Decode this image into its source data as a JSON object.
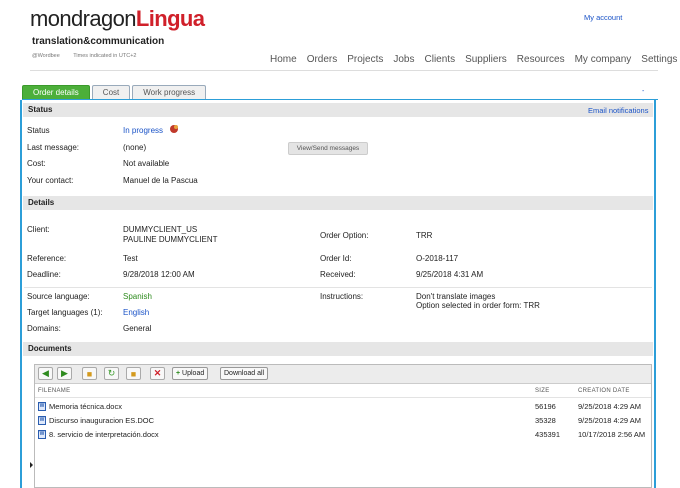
{
  "header": {
    "logo_part1": "mondragon",
    "logo_part2": "Lingua",
    "tagline": "translation&communication",
    "sub_info_1": "@Wordbee",
    "sub_info_2": "Times indicated in UTC+2",
    "my_account": "My account",
    "nav": [
      "Home",
      "Orders",
      "Projects",
      "Jobs",
      "Clients",
      "Suppliers",
      "Resources",
      "My company",
      "Settings"
    ]
  },
  "tabs": [
    "Order details",
    "Cost",
    "Work progress"
  ],
  "tab_right_marker": "-",
  "status_section": {
    "title": "Status",
    "email_link": "Email notifications",
    "status_label": "Status",
    "status_value": "In progress",
    "last_message_label": "Last message:",
    "last_message_value": "(none)",
    "view_send_button": "View/Send messages",
    "cost_label": "Cost:",
    "cost_value": "Not available",
    "contact_label": "Your contact:",
    "contact_value": "Manuel de la Pascua"
  },
  "details_section": {
    "title": "Details",
    "client_label": "Client:",
    "client_line1": "DUMMYCLIENT_US",
    "client_line2": "PAULINE DUMMYCLIENT",
    "order_option_label": "Order Option:",
    "order_option_value": "TRR",
    "reference_label": "Reference:",
    "reference_value": "Test",
    "order_id_label": "Order Id:",
    "order_id_value": "O-2018-117",
    "deadline_label": "Deadline:",
    "deadline_value": "9/28/2018 12:00 AM",
    "received_label": "Received:",
    "received_value": "9/25/2018 4:31 AM",
    "source_label": "Source language:",
    "source_value": "Spanish",
    "instructions_label": "Instructions:",
    "instructions_line1": "Don't translate images",
    "instructions_line2": "Option selected in order form: TRR",
    "target_label": "Target languages (1):",
    "target_value": "English",
    "domains_label": "Domains:",
    "domains_value": "General"
  },
  "documents_section": {
    "title": "Documents",
    "upload_button": "Upload",
    "download_all_button": "Download all",
    "columns": [
      "FILENAME",
      "SIZE",
      "CREATION DATE"
    ],
    "files": [
      {
        "name": "Memoria técnica.docx",
        "size": "56196",
        "date": "9/25/2018 4:29 AM"
      },
      {
        "name": "Discurso inauguracion ES.DOC",
        "size": "35328",
        "date": "9/25/2018 4:29 AM"
      },
      {
        "name": "8. servicio de interpretación.docx",
        "size": "435391",
        "date": "10/17/2018 2:56 AM"
      }
    ]
  },
  "colors": {
    "accent_blue": "#2c9ed8",
    "link_blue": "#1a53c7",
    "brand_red": "#d0202a",
    "tab_green": "#4caf3a",
    "language_green": "#2e8b1e"
  }
}
